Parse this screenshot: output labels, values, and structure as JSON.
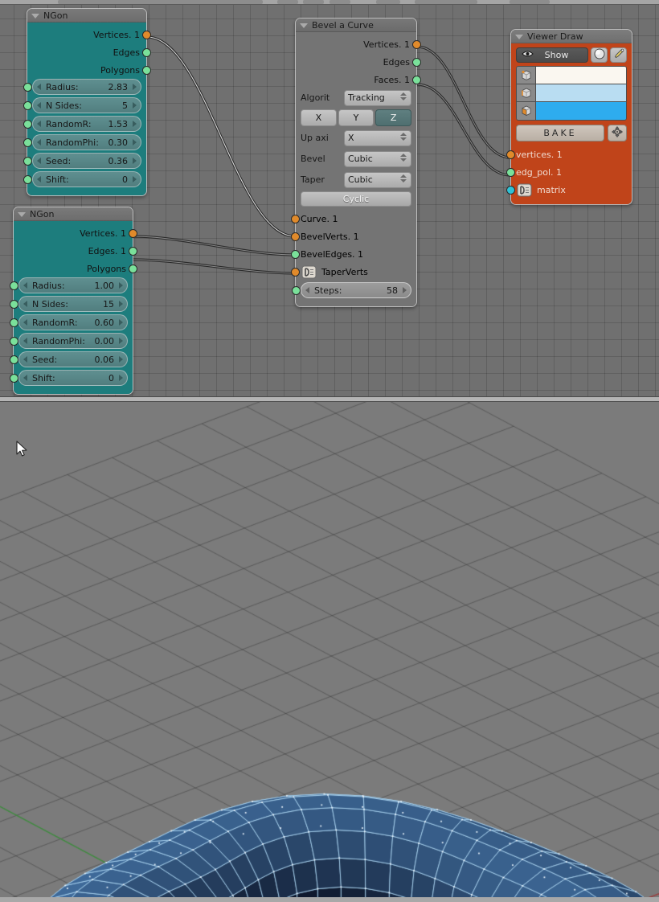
{
  "app": {
    "editor_name": "node-editor",
    "viewport_name": "3d-viewport"
  },
  "colors": {
    "node_teal": "#1d7d7d",
    "node_grey": "#747474",
    "node_orange": "#c0441a",
    "socket_vertices": "#e08a2b",
    "socket_edges": "#7ae09a",
    "socket_matrix": "#2fc2d6",
    "editor_background": "#707070",
    "viewport_background": "#7b7b7b",
    "mesh_blue": "#2f6fa8",
    "wire_blue": "#9fd0ef",
    "axis_x": "#a04040",
    "axis_y": "#3f8f3f"
  },
  "nodes": {
    "ngon1": {
      "title": "NGon",
      "outputs": [
        {
          "label": "Vertices. 1",
          "type": "v"
        },
        {
          "label": "Edges",
          "type": "e"
        },
        {
          "label": "Polygons",
          "type": "e"
        }
      ],
      "params": [
        {
          "label": "Radius:",
          "value": "2.83"
        },
        {
          "label": "N Sides:",
          "value": "5"
        },
        {
          "label": "RandomR:",
          "value": "1.53"
        },
        {
          "label": "RandomPhi:",
          "value": "0.30"
        },
        {
          "label": "Seed:",
          "value": "0.36"
        },
        {
          "label": "Shift:",
          "value": "0"
        }
      ]
    },
    "ngon2": {
      "title": "NGon",
      "outputs": [
        {
          "label": "Vertices. 1",
          "type": "v"
        },
        {
          "label": "Edges. 1",
          "type": "e"
        },
        {
          "label": "Polygons",
          "type": "e"
        }
      ],
      "params": [
        {
          "label": "Radius:",
          "value": "1.00"
        },
        {
          "label": "N Sides:",
          "value": "15"
        },
        {
          "label": "RandomR:",
          "value": "0.60"
        },
        {
          "label": "RandomPhi:",
          "value": "0.00"
        },
        {
          "label": "Seed:",
          "value": "0.06"
        },
        {
          "label": "Shift:",
          "value": "0"
        }
      ]
    },
    "bevel": {
      "title": "Bevel a Curve",
      "outputs": [
        {
          "label": "Vertices. 1",
          "type": "v"
        },
        {
          "label": "Edges",
          "type": "e"
        },
        {
          "label": "Faces. 1",
          "type": "e"
        }
      ],
      "algorithm_label": "Algorit",
      "algorithm_value": "Tracking",
      "axis_options": [
        "X",
        "Y",
        "Z"
      ],
      "axis_selected": "Z",
      "upaxis_label": "Up axi",
      "upaxis_value": "X",
      "bevel_label": "Bevel",
      "bevel_value": "Cubic",
      "taper_label": "Taper",
      "taper_value": "Cubic",
      "cyclic_label": "Cyclic",
      "inputs": [
        {
          "label": "Curve. 1",
          "type": "v"
        },
        {
          "label": "BevelVerts. 1",
          "type": "v"
        },
        {
          "label": "BevelEdges. 1",
          "type": "e"
        },
        {
          "label": "TaperVerts",
          "type": "v",
          "icon": "plug-icon"
        }
      ],
      "steps": {
        "label": "Steps:",
        "value": "58"
      }
    },
    "viewer": {
      "title": "Viewer Draw",
      "show_label": "Show",
      "show_icon": "eye-icon",
      "sphere_icon": "sphere-icon",
      "brush_icon": "brush-icon",
      "color_rows": [
        {
          "icon": "vertex-cube-icon",
          "color": "#faf7f0"
        },
        {
          "icon": "edge-cube-icon",
          "color": "#b9ddf2"
        },
        {
          "icon": "face-cube-icon",
          "color": "#2eacee"
        }
      ],
      "bake_label": "BAKE",
      "gear_icon": "target-icon",
      "inputs": [
        {
          "label": "vertices. 1",
          "type": "v"
        },
        {
          "label": "edg_pol. 1",
          "type": "e"
        },
        {
          "label": "matrix",
          "type": "m",
          "icon": "plug-icon"
        }
      ]
    }
  },
  "viewport": {
    "cursor_icon": "mouse-pointer-icon",
    "three_d_cursor_icon": "3d-cursor-icon",
    "object": "bevelled-torus-mesh"
  }
}
